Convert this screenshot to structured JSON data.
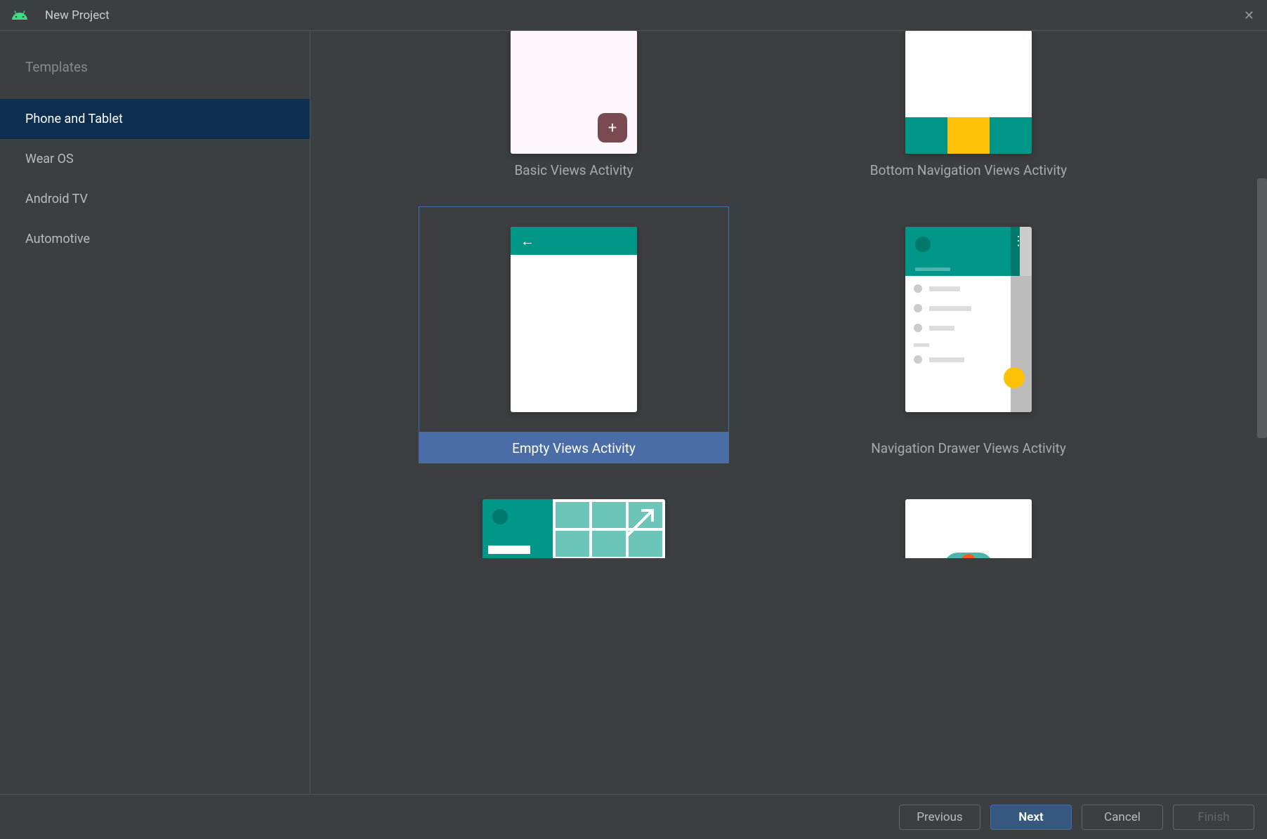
{
  "window": {
    "title": "New Project"
  },
  "sidebar": {
    "header": "Templates",
    "items": [
      {
        "label": "Phone and Tablet",
        "selected": true
      },
      {
        "label": "Wear OS",
        "selected": false
      },
      {
        "label": "Android TV",
        "selected": false
      },
      {
        "label": "Automotive",
        "selected": false
      }
    ]
  },
  "templates": {
    "row1": [
      {
        "label": "Basic Views Activity",
        "selected": false
      },
      {
        "label": "Bottom Navigation Views Activity",
        "selected": false
      }
    ],
    "row2": [
      {
        "label": "Empty Views Activity",
        "selected": true
      },
      {
        "label": "Navigation Drawer Views Activity",
        "selected": false
      }
    ]
  },
  "footer": {
    "previous": "Previous",
    "next": "Next",
    "cancel": "Cancel",
    "finish": "Finish"
  }
}
